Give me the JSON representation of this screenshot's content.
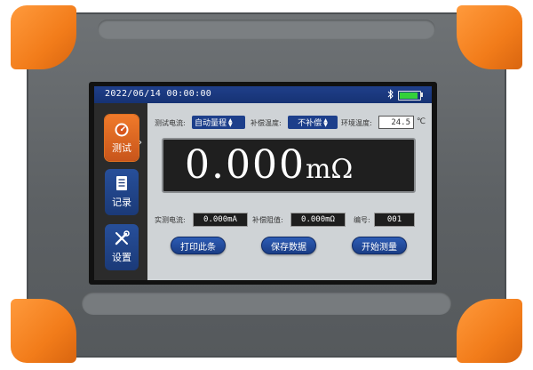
{
  "status": {
    "datetime": "2022/06/14 00:00:00",
    "bluetooth_icon": "bluetooth-icon",
    "battery_level": 0.9,
    "battery_color": "#34d13a"
  },
  "sidebar": {
    "items": [
      {
        "label": "测试",
        "icon": "gauge-icon",
        "active": true
      },
      {
        "label": "记录",
        "icon": "document-icon",
        "active": false
      },
      {
        "label": "设置",
        "icon": "wrench-screwdriver-icon",
        "active": false
      }
    ]
  },
  "controls": {
    "current_label": "测试电流:",
    "current_value": "自动量程",
    "temp_comp_label": "补偿温度:",
    "temp_comp_value": "不补偿",
    "env_temp_label": "环境温度:",
    "env_temp_value": "24.5",
    "env_temp_unit": "℃"
  },
  "reading": {
    "value": "0.000",
    "unit": "mΩ"
  },
  "info": {
    "actual_current_label": "实测电流:",
    "actual_current_value": "0.000mA",
    "comp_resistance_label": "补偿阻值:",
    "comp_resistance_value": "0.000mΩ",
    "number_label": "编号:",
    "number_value": "001"
  },
  "buttons": {
    "print": "打印此条",
    "save": "保存数据",
    "start": "开始测量"
  },
  "colors": {
    "housing": "#5d6164",
    "bumper": "#f27c1a",
    "screen_header": "#1f3f8a",
    "accent_active": "#f07a2a"
  }
}
